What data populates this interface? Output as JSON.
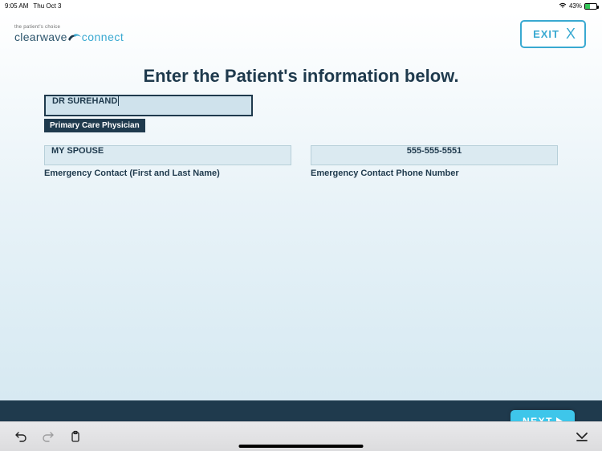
{
  "status": {
    "time": "9:05 AM",
    "date": "Thu Oct 3",
    "battery_pct": "43%",
    "wifi_icon": "wifi-icon",
    "battery_icon": "battery-icon"
  },
  "brand": {
    "tagline": "the patient's choice",
    "name1": "clearwave",
    "name2": "connect"
  },
  "header": {
    "exit_label": "EXIT",
    "exit_x": "X"
  },
  "headline": "Enter the Patient's information below.",
  "fields": {
    "primary_care": {
      "value": "DR SUREHAND",
      "label": "Primary Care Physician"
    },
    "emergency_name": {
      "value": "MY SPOUSE",
      "label": "Emergency Contact (First and Last Name)"
    },
    "emergency_phone": {
      "value": "555-555-5551",
      "label": "Emergency Contact Phone Number"
    }
  },
  "footer": {
    "next_label": "NEXT"
  },
  "toolbar": {
    "undo": "undo-icon",
    "redo": "redo-icon",
    "paste": "clipboard-icon",
    "keyboard_dismiss": "keyboard-down-icon"
  }
}
